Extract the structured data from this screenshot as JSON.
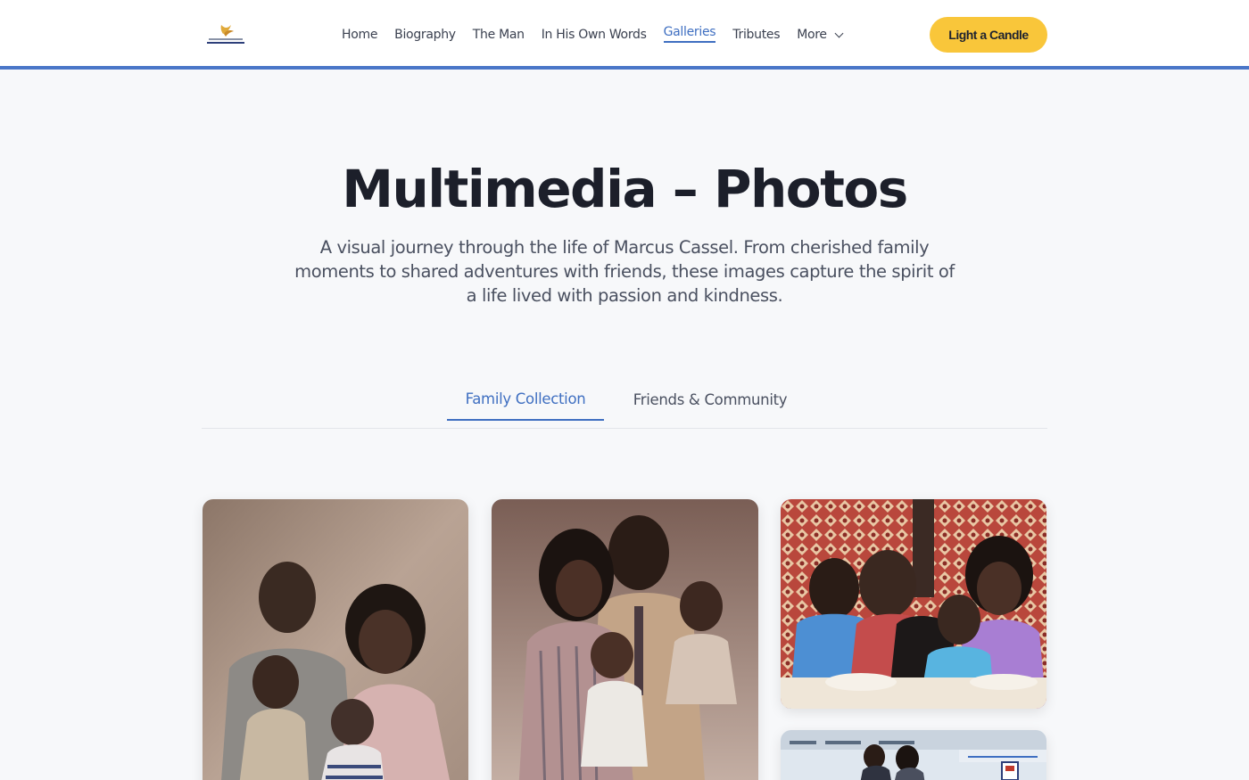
{
  "header": {
    "nav": [
      {
        "label": "Home"
      },
      {
        "label": "Biography"
      },
      {
        "label": "The Man"
      },
      {
        "label": "In His Own Words"
      },
      {
        "label": "Galleries",
        "active": true
      },
      {
        "label": "Tributes"
      },
      {
        "label": "More"
      }
    ],
    "cta_label": "Light a Candle",
    "accent_color": "#4a76c8",
    "cta_color": "#f9c63a"
  },
  "hero": {
    "title": "Multimedia – Photos",
    "subtitle": "A visual journey through the life of Marcus Cassel. From cherished family moments to shared adventures with friends, these images capture the spirit of a life lived with passion and kindness."
  },
  "tabs": [
    {
      "label": "Family Collection",
      "active": true
    },
    {
      "label": "Friends & Community",
      "active": false
    }
  ],
  "gallery": {
    "photos": [
      {
        "subject": "family-portrait-icon"
      },
      {
        "subject": "family-portrait-icon"
      },
      {
        "subject": "family-dinner-icon"
      },
      {
        "subject": "cruise-ship-icon"
      }
    ]
  }
}
